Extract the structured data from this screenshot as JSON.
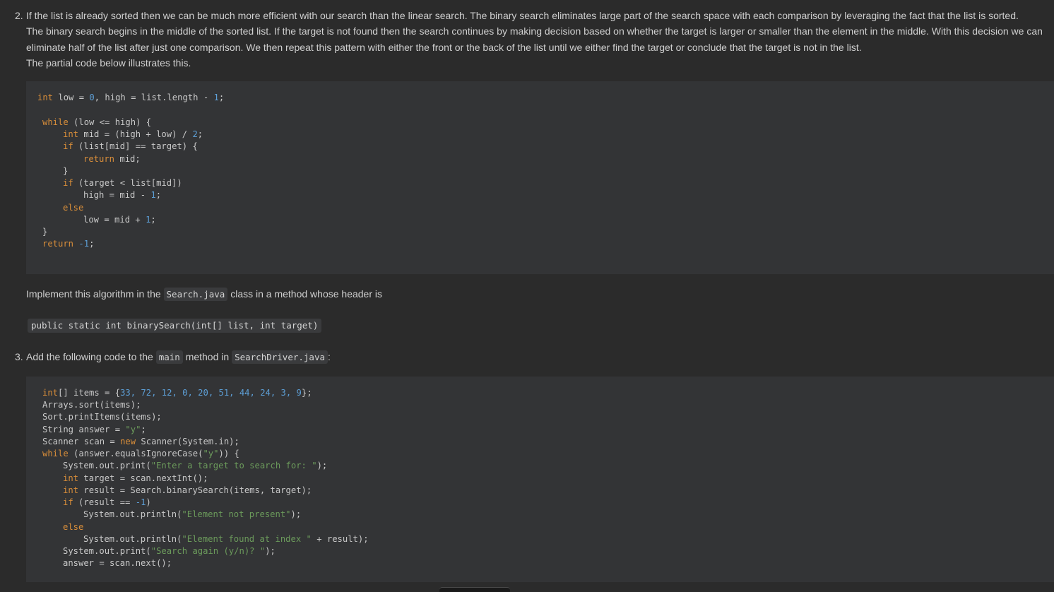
{
  "item2": {
    "number": "2.",
    "lines": [
      "If the list is already sorted then we can be much more efficient with our search than the linear search. The binary search eliminates large part of the search space with each comparison by leveraging the fact that the list is sorted.",
      "The binary search begins in the middle of the sorted list. If the target is not found then the search continues by making decision based on whether the target is larger or smaller than the element in the middle. With this decision we can",
      "eliminate half of the list after just one comparison. We then repeat this pattern with either the front or the back of the list until we either find the target or conclude that the target is not in the list.",
      "The partial code below illustrates this."
    ],
    "code1": {
      "l1": {
        "kw": "int",
        "a": " low = ",
        "n1": "0",
        "b": ", high = list.length - ",
        "n2": "1",
        "c": ";"
      },
      "l2": {
        "kw": "while",
        "a": " (low <= high) {"
      },
      "l3": {
        "kw": "int",
        "a": " mid = (high + low) / ",
        "n": "2",
        "b": ";"
      },
      "l4": {
        "kw": "if",
        "a": " (list[mid] == target) {"
      },
      "l5": {
        "kw": "return",
        "a": " mid;"
      },
      "l6": {
        "a": "}"
      },
      "l7": {
        "kw": "if",
        "a": " (target < list[mid])"
      },
      "l8": {
        "a": "high = mid - ",
        "n": "1",
        "b": ";"
      },
      "l9": {
        "kw": "else"
      },
      "l10": {
        "a": "low = mid + ",
        "n": "1",
        "b": ";"
      },
      "l11": {
        "a": "}"
      },
      "l12": {
        "kw": "return",
        "a": " ",
        "n": "-1",
        "b": ";"
      }
    },
    "implement_before": "Implement this algorithm in the",
    "implement_code": "Search.java",
    "implement_after": "class in a method whose header is",
    "method_header": "public static int binarySearch(int[] list, int target)"
  },
  "item3": {
    "number": "3.",
    "text_before": "Add the following code to the",
    "code_main": "main",
    "text_mid": "method in",
    "code_file": "SearchDriver.java",
    "text_after": ":",
    "code2": {
      "l1": {
        "kw": "int",
        "a": "[] items = {",
        "nums": "33, 72, 12, 0, 20, 51, 44, 24, 3, 9",
        "b": "};"
      },
      "l2": {
        "a": "Arrays.sort(items);"
      },
      "l3": {
        "a": "Sort.printItems(items);"
      },
      "l4": {
        "a": "String answer = ",
        "s": "\"y\"",
        "b": ";"
      },
      "l5": {
        "a": "Scanner scan = ",
        "kw": "new",
        "b": " Scanner(System.in);"
      },
      "l6": {
        "kw": "while",
        "a": " (answer.equalsIgnoreCase(",
        "s": "\"y\"",
        "b": ")) {"
      },
      "l7": {
        "a": "System.out.print(",
        "s": "\"Enter a target to search for: \"",
        "b": ");"
      },
      "l8": {
        "kw": "int",
        "a": " target = scan.nextInt();"
      },
      "l9": {
        "kw": "int",
        "a": " result = Search.binarySearch(items, target);"
      },
      "l10": {
        "kw": "if",
        "a": " (result == ",
        "n": "-1",
        "b": ")"
      },
      "l11": {
        "a": "System.out.println(",
        "s": "\"Element not present\"",
        "b": ");"
      },
      "l12": {
        "kw": "else"
      },
      "l13": {
        "a": "System.out.println(",
        "s": "\"Element found at index \"",
        "b": " + result);"
      },
      "l14": {
        "a": "System.out.print(",
        "s": "\"Search again (y/n)? \"",
        "b": ");"
      },
      "l15": {
        "a": "answer = scan.next();"
      }
    }
  },
  "colors": {
    "background": "#2b2b2b",
    "code_bg": "#333436",
    "keyword": "#d98e3a",
    "number": "#5d9fd6",
    "string": "#6b9a5b"
  }
}
